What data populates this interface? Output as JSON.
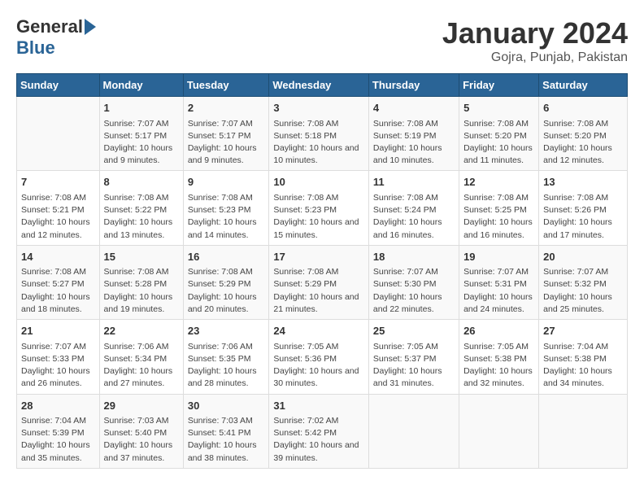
{
  "header": {
    "logo_general": "General",
    "logo_blue": "Blue",
    "month_title": "January 2024",
    "location": "Gojra, Punjab, Pakistan"
  },
  "calendar": {
    "weekdays": [
      "Sunday",
      "Monday",
      "Tuesday",
      "Wednesday",
      "Thursday",
      "Friday",
      "Saturday"
    ],
    "weeks": [
      [
        {
          "day": "",
          "content": ""
        },
        {
          "day": "1",
          "content": "Sunrise: 7:07 AM\nSunset: 5:17 PM\nDaylight: 10 hours\nand 9 minutes."
        },
        {
          "day": "2",
          "content": "Sunrise: 7:07 AM\nSunset: 5:17 PM\nDaylight: 10 hours\nand 9 minutes."
        },
        {
          "day": "3",
          "content": "Sunrise: 7:08 AM\nSunset: 5:18 PM\nDaylight: 10 hours\nand 10 minutes."
        },
        {
          "day": "4",
          "content": "Sunrise: 7:08 AM\nSunset: 5:19 PM\nDaylight: 10 hours\nand 10 minutes."
        },
        {
          "day": "5",
          "content": "Sunrise: 7:08 AM\nSunset: 5:20 PM\nDaylight: 10 hours\nand 11 minutes."
        },
        {
          "day": "6",
          "content": "Sunrise: 7:08 AM\nSunset: 5:20 PM\nDaylight: 10 hours\nand 12 minutes."
        }
      ],
      [
        {
          "day": "7",
          "content": "Sunrise: 7:08 AM\nSunset: 5:21 PM\nDaylight: 10 hours\nand 12 minutes."
        },
        {
          "day": "8",
          "content": "Sunrise: 7:08 AM\nSunset: 5:22 PM\nDaylight: 10 hours\nand 13 minutes."
        },
        {
          "day": "9",
          "content": "Sunrise: 7:08 AM\nSunset: 5:23 PM\nDaylight: 10 hours\nand 14 minutes."
        },
        {
          "day": "10",
          "content": "Sunrise: 7:08 AM\nSunset: 5:23 PM\nDaylight: 10 hours\nand 15 minutes."
        },
        {
          "day": "11",
          "content": "Sunrise: 7:08 AM\nSunset: 5:24 PM\nDaylight: 10 hours\nand 16 minutes."
        },
        {
          "day": "12",
          "content": "Sunrise: 7:08 AM\nSunset: 5:25 PM\nDaylight: 10 hours\nand 16 minutes."
        },
        {
          "day": "13",
          "content": "Sunrise: 7:08 AM\nSunset: 5:26 PM\nDaylight: 10 hours\nand 17 minutes."
        }
      ],
      [
        {
          "day": "14",
          "content": "Sunrise: 7:08 AM\nSunset: 5:27 PM\nDaylight: 10 hours\nand 18 minutes."
        },
        {
          "day": "15",
          "content": "Sunrise: 7:08 AM\nSunset: 5:28 PM\nDaylight: 10 hours\nand 19 minutes."
        },
        {
          "day": "16",
          "content": "Sunrise: 7:08 AM\nSunset: 5:29 PM\nDaylight: 10 hours\nand 20 minutes."
        },
        {
          "day": "17",
          "content": "Sunrise: 7:08 AM\nSunset: 5:29 PM\nDaylight: 10 hours\nand 21 minutes."
        },
        {
          "day": "18",
          "content": "Sunrise: 7:07 AM\nSunset: 5:30 PM\nDaylight: 10 hours\nand 22 minutes."
        },
        {
          "day": "19",
          "content": "Sunrise: 7:07 AM\nSunset: 5:31 PM\nDaylight: 10 hours\nand 24 minutes."
        },
        {
          "day": "20",
          "content": "Sunrise: 7:07 AM\nSunset: 5:32 PM\nDaylight: 10 hours\nand 25 minutes."
        }
      ],
      [
        {
          "day": "21",
          "content": "Sunrise: 7:07 AM\nSunset: 5:33 PM\nDaylight: 10 hours\nand 26 minutes."
        },
        {
          "day": "22",
          "content": "Sunrise: 7:06 AM\nSunset: 5:34 PM\nDaylight: 10 hours\nand 27 minutes."
        },
        {
          "day": "23",
          "content": "Sunrise: 7:06 AM\nSunset: 5:35 PM\nDaylight: 10 hours\nand 28 minutes."
        },
        {
          "day": "24",
          "content": "Sunrise: 7:05 AM\nSunset: 5:36 PM\nDaylight: 10 hours\nand 30 minutes."
        },
        {
          "day": "25",
          "content": "Sunrise: 7:05 AM\nSunset: 5:37 PM\nDaylight: 10 hours\nand 31 minutes."
        },
        {
          "day": "26",
          "content": "Sunrise: 7:05 AM\nSunset: 5:38 PM\nDaylight: 10 hours\nand 32 minutes."
        },
        {
          "day": "27",
          "content": "Sunrise: 7:04 AM\nSunset: 5:38 PM\nDaylight: 10 hours\nand 34 minutes."
        }
      ],
      [
        {
          "day": "28",
          "content": "Sunrise: 7:04 AM\nSunset: 5:39 PM\nDaylight: 10 hours\nand 35 minutes."
        },
        {
          "day": "29",
          "content": "Sunrise: 7:03 AM\nSunset: 5:40 PM\nDaylight: 10 hours\nand 37 minutes."
        },
        {
          "day": "30",
          "content": "Sunrise: 7:03 AM\nSunset: 5:41 PM\nDaylight: 10 hours\nand 38 minutes."
        },
        {
          "day": "31",
          "content": "Sunrise: 7:02 AM\nSunset: 5:42 PM\nDaylight: 10 hours\nand 39 minutes."
        },
        {
          "day": "",
          "content": ""
        },
        {
          "day": "",
          "content": ""
        },
        {
          "day": "",
          "content": ""
        }
      ]
    ]
  }
}
